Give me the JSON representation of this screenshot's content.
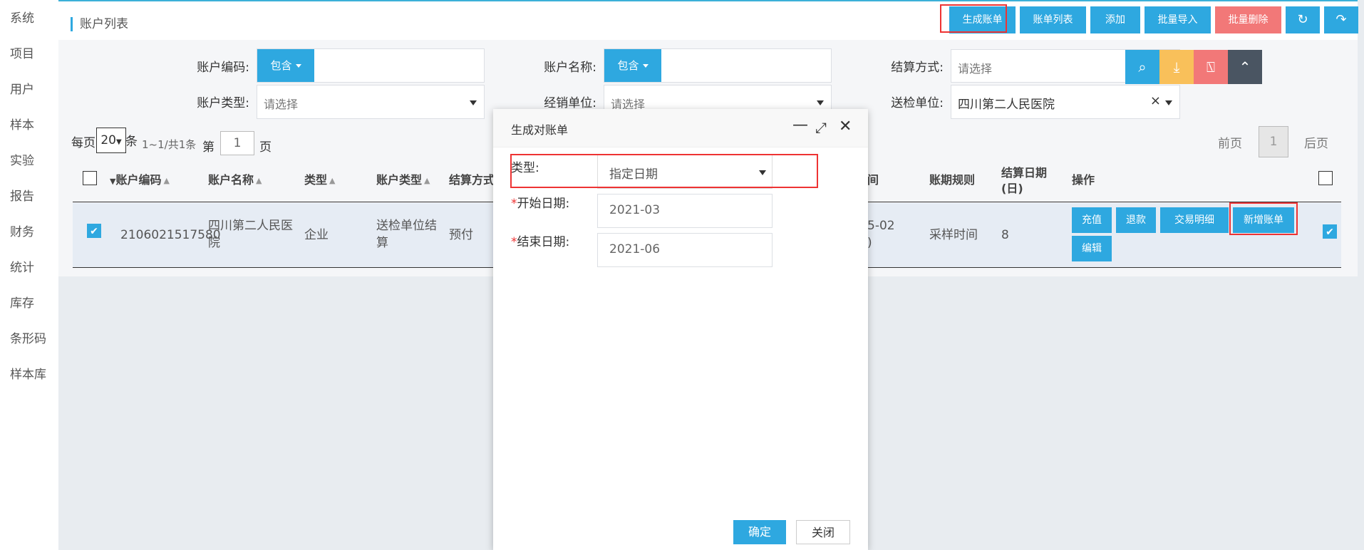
{
  "sidebar": {
    "items": [
      {
        "label": "系统"
      },
      {
        "label": "项目"
      },
      {
        "label": "用户"
      },
      {
        "label": "样本"
      },
      {
        "label": "实验"
      },
      {
        "label": "报告"
      },
      {
        "label": "财务"
      },
      {
        "label": "统计"
      },
      {
        "label": "库存"
      },
      {
        "label": "条形码"
      },
      {
        "label": "样本库"
      }
    ]
  },
  "header": {
    "title": "账户列表",
    "buttons": {
      "generate_bill": "生成账单",
      "bill_list": "账单列表",
      "add": "添加",
      "batch_import": "批量导入",
      "batch_delete": "批量删除"
    }
  },
  "filters": {
    "account_code_label": "账户编码:",
    "account_name_label": "账户名称:",
    "settlement_label": "结算方式:",
    "account_type_label": "账户类型:",
    "dealer_label": "经销单位:",
    "submit_unit_label": "送检单位:",
    "contains_label": "包含",
    "select_placeholder": "请选择",
    "submit_unit_value": "四川第二人民医院",
    "clear_symbol": "×"
  },
  "pagination": {
    "per_page_label": "每页",
    "per_page_value": "20",
    "per_page_unit": "条",
    "summary": "1~1/共1条",
    "page_prefix": "第",
    "page_value": "1",
    "page_suffix": "页",
    "prev": "前页",
    "current": "1",
    "next": "后页"
  },
  "table": {
    "headers": {
      "account_code": "账户编码",
      "account_name": "账户名称",
      "type": "类型",
      "account_type": "账户类型",
      "settlement": "结算方式",
      "time_fragment": "间",
      "period_rule": "账期规则",
      "settle_day_1": "结算日期",
      "settle_day_2": "(日)",
      "ops": "操作"
    },
    "row": {
      "account_code": "2106021517580",
      "account_name_1": "四川第二人民医",
      "account_name_2": "院",
      "type": "企业",
      "account_type_1": "送检单位结",
      "account_type_2": "算",
      "settlement": "预付",
      "time_fragment_1": "5-02",
      "time_fragment_2": ")",
      "period_rule": "采样时间",
      "settle_day": "8",
      "ops": {
        "recharge": "充值",
        "refund": "退款",
        "transactions": "交易明细",
        "new_bill": "新增账单",
        "edit": "编辑"
      }
    }
  },
  "modal": {
    "title": "生成对账单",
    "type_label": "类型:",
    "type_value": "指定日期",
    "required_mark": "*",
    "start_label": "开始日期:",
    "start_value": "2021-03",
    "end_label": "结束日期:",
    "end_value": "2021-06",
    "confirm": "确定",
    "close": "关闭"
  },
  "icons": {
    "search": "search-icon",
    "download": "download-icon",
    "clear": "broom-icon",
    "collapse": "chevron-up-icon",
    "refresh": "refresh-icon",
    "back": "undo-icon"
  },
  "colors": {
    "primary": "#2ea8e0",
    "danger": "#f27878",
    "warning": "#f9c05a",
    "dark": "#4a5562",
    "highlight": "#e33333"
  }
}
